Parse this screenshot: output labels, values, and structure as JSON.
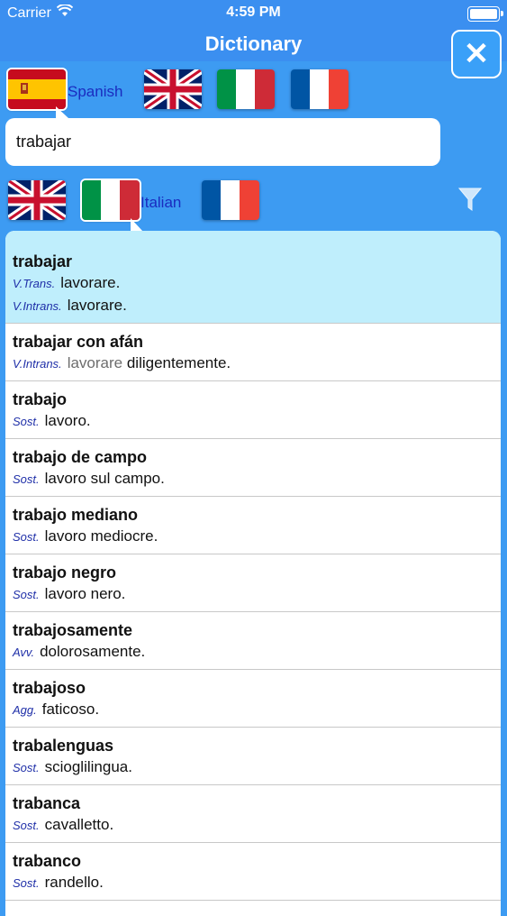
{
  "status": {
    "carrier": "Carrier",
    "time": "4:59 PM",
    "battery_level": 1.0
  },
  "nav": {
    "title": "Dictionary",
    "close_label": "✕"
  },
  "source_languages": {
    "selected_label": "Spanish",
    "flags": [
      "spain-flag",
      "uk-flag",
      "italy-flag",
      "france-flag"
    ]
  },
  "search": {
    "value": "trabajar"
  },
  "target_languages": {
    "selected_label": "Italian",
    "flags": [
      "uk-flag",
      "italy-flag",
      "france-flag"
    ]
  },
  "entries": [
    {
      "term": "trabajar",
      "senses": [
        {
          "pos": "V.Trans.",
          "text": "lavorare."
        },
        {
          "pos": "V.Intrans.",
          "text": "lavorare."
        }
      ],
      "highlighted": true
    },
    {
      "term": "trabajar con afán",
      "senses": [
        {
          "pos": "V.Intrans.",
          "text_gray": "lavorare",
          "text": " diligentemente."
        }
      ]
    },
    {
      "term": "trabajo",
      "senses": [
        {
          "pos": "Sost.",
          "text": "lavoro."
        }
      ]
    },
    {
      "term": "trabajo de campo",
      "senses": [
        {
          "pos": "Sost.",
          "text": "lavoro sul campo."
        }
      ]
    },
    {
      "term": "trabajo mediano",
      "senses": [
        {
          "pos": "Sost.",
          "text": "lavoro mediocre."
        }
      ]
    },
    {
      "term": "trabajo negro",
      "senses": [
        {
          "pos": "Sost.",
          "text": "lavoro nero."
        }
      ]
    },
    {
      "term": "trabajosamente",
      "senses": [
        {
          "pos": "Avv.",
          "text": "dolorosamente."
        }
      ]
    },
    {
      "term": "trabajoso",
      "senses": [
        {
          "pos": "Agg.",
          "text": "faticoso."
        }
      ]
    },
    {
      "term": "trabalenguas",
      "senses": [
        {
          "pos": "Sost.",
          "text": "scioglilingua."
        }
      ]
    },
    {
      "term": "trabanca",
      "senses": [
        {
          "pos": "Sost.",
          "text": "cavalletto."
        }
      ]
    },
    {
      "term": "trabanco",
      "senses": [
        {
          "pos": "Sost.",
          "text": "randello."
        }
      ]
    }
  ],
  "colors": {
    "nav_blue": "#3b8ff0",
    "background_blue": "#3d9bf2",
    "highlight": "#bfeefc",
    "pos_blue": "#1f2fa8"
  }
}
